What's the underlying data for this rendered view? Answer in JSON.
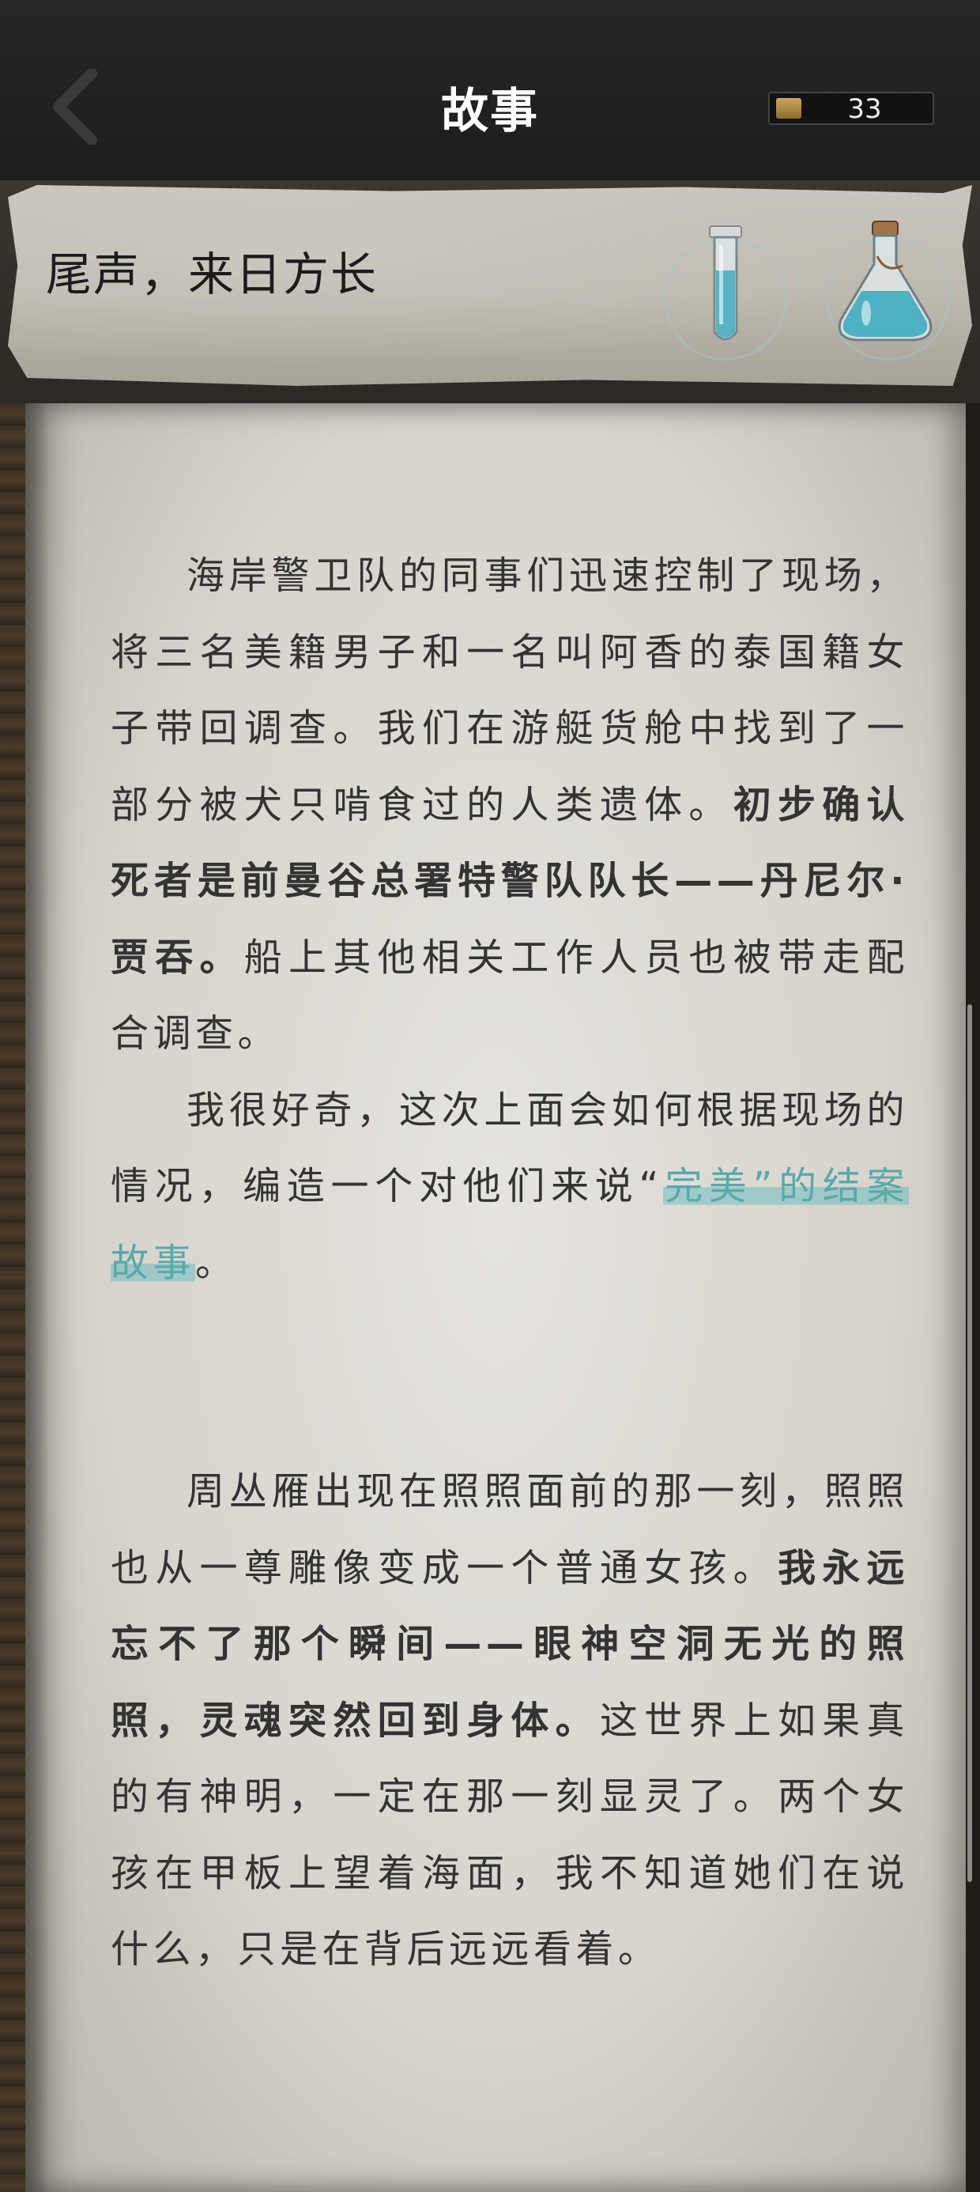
{
  "header": {
    "title": "故事",
    "currency_value": "33"
  },
  "chapter": {
    "title": "尾声，来日方长"
  },
  "icons": {
    "back": "chevron-left-icon",
    "currency": "gold-ingot-icon",
    "item1": "test-tube-icon",
    "item2": "flask-icon"
  },
  "colors": {
    "header_bg": "#222222",
    "text": "#333333",
    "highlight": "#5aa9ab",
    "potion": "#5bb8c8"
  },
  "story": {
    "p1": {
      "a": "海岸警卫队的同事们迅速控制了现场，将三名美籍男子和一名叫阿香的泰国籍女子带回调查。我们在游艇货舱中找到了一部分被犬只啃食过的人类遗体。",
      "b": "初步确认死者是前曼谷总署特警队队长——丹尼尔·贾吞。",
      "c": "船上其他相关工作人员也被带走配合调查。"
    },
    "p2": {
      "a": "我很好奇，这次上面会如何根据现场的情况，编造一个对他们来说“",
      "hl1": "完",
      "hl2": "美”的结案故事",
      "b": "。"
    },
    "p3": {
      "a": "周丛雁出现在照照面前的那一刻，照照也从一尊雕像变成一个普通女孩。",
      "b": "我永远忘不了那个瞬间——眼神空洞无光的照照，灵魂突然回到身体。",
      "c": "这世界上如果真的有神明，一定在那一刻显灵了。两个女孩在甲板上望着海面，我不知道她们在说什么，只是在背后远远看着。"
    }
  }
}
